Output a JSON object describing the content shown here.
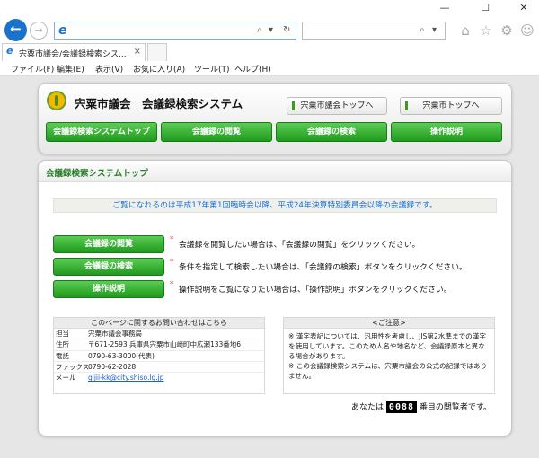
{
  "window": {
    "minimize": "—",
    "maximize": "☐",
    "close": "✕"
  },
  "browser": {
    "back_icon": "←",
    "forward_icon": "→",
    "url_value": "",
    "search_value": "",
    "search_icon": "⌕",
    "dropdown_icon": "▾",
    "refresh_icon": "↻",
    "ie_icon": "e",
    "tab_title": "宍粟市議会/会議録検索シス...",
    "tab_close": "×"
  },
  "menu": [
    "ファイル(F)",
    "編集(E)",
    "表示(V)",
    "お気に入り(A)",
    "ツール(T)",
    "ヘルプ(H)"
  ],
  "header": {
    "title": "宍粟市議会　会議録検索システム",
    "top_buttons": [
      "宍粟市議会トップへ",
      "宍粟市トップへ"
    ]
  },
  "nav": [
    "会議録検索システムトップ",
    "会議録の閲覧",
    "会議録の検索",
    "操作説明"
  ],
  "main": {
    "section_title": "会議録検索システムトップ",
    "notice": "ご覧になれるのは平成17年第1回臨時会以降、平成24年決算特別委員会以降の会議録です。",
    "actions": [
      {
        "label": "会議録の閲覧",
        "star": "*",
        "desc": "会議録を閲覧したい場合は、「会議録の閲覧」をクリックください。"
      },
      {
        "label": "会議録の検索",
        "star": "*",
        "desc": "条件を指定して検索したい場合は、「会議録の検索」ボタンをクリックください。"
      },
      {
        "label": "操作説明",
        "star": "*",
        "desc": "操作説明をご覧になりたい場合は、「操作説明」ボタンをクリックください。"
      }
    ],
    "contact": {
      "title": "このページに関するお問い合わせはこちら",
      "rows": [
        {
          "key": "担当",
          "value": "宍粟市議会事務局"
        },
        {
          "key": "住所",
          "value": "〒671-2593 兵庫県宍粟市山崎町中広瀬133番地6"
        },
        {
          "key": "電話",
          "value": "0790-63-3000(代表)"
        },
        {
          "key": "ファックス",
          "value": "0790-62-2028"
        },
        {
          "key": "メール",
          "value": "gijii-kk@city.shiso.lg.jp"
        }
      ]
    },
    "caution": {
      "title": "<ご注意>",
      "lines": [
        "※ 漢字表記については、汎用性を考慮し、JIS第2水準までの漢字を使用しています。このため人名や地名など、会議録原本と異なる場合があります。",
        "※ この会議録検索システムは、宍粟市議会の公式の記録ではありません。"
      ]
    },
    "counter": {
      "prefix": "あなたは",
      "digits": "0088",
      "suffix": "番目の閲覧者です。"
    }
  }
}
